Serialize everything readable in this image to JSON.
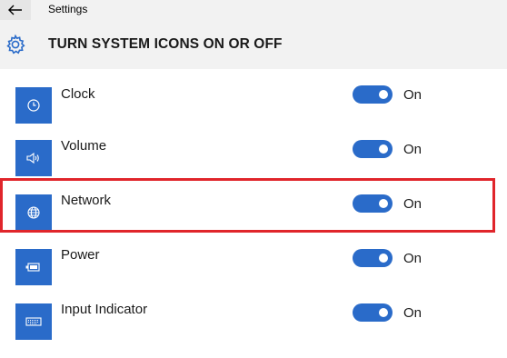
{
  "window": {
    "title": "Settings"
  },
  "header": {
    "title": "TURN SYSTEM ICONS ON OR OFF"
  },
  "items": [
    {
      "label": "Clock",
      "state": "On",
      "icon": "clock-icon",
      "enabled": true
    },
    {
      "label": "Volume",
      "state": "On",
      "icon": "volume-icon",
      "enabled": true
    },
    {
      "label": "Network",
      "state": "On",
      "icon": "network-globe-icon",
      "enabled": true
    },
    {
      "label": "Power",
      "state": "On",
      "icon": "battery-icon",
      "enabled": true
    },
    {
      "label": "Input Indicator",
      "state": "On",
      "icon": "keyboard-icon",
      "enabled": true
    }
  ],
  "colors": {
    "accent": "#2a6bc9",
    "highlight": "#e0252b",
    "header_bg": "#f2f2f2"
  }
}
